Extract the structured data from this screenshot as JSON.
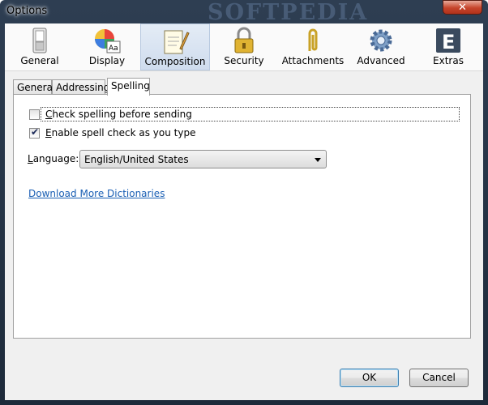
{
  "window": {
    "title": "Options",
    "watermark": "SOFTPEDIA",
    "close_label": "✕"
  },
  "toolbar": {
    "items": [
      {
        "label": "General",
        "icon": "switch-icon"
      },
      {
        "label": "Display",
        "icon": "color-wheel-icon"
      },
      {
        "label": "Composition",
        "icon": "notepad-pencil-icon",
        "selected": true
      },
      {
        "label": "Security",
        "icon": "padlock-icon"
      },
      {
        "label": "Attachments",
        "icon": "paperclip-icon"
      },
      {
        "label": "Advanced",
        "icon": "gear-icon"
      },
      {
        "label": "Extras",
        "icon": "extras-e-icon"
      }
    ]
  },
  "tabs": [
    {
      "label": "General"
    },
    {
      "label": "Addressing"
    },
    {
      "label": "Spelling",
      "active": true
    }
  ],
  "spelling": {
    "check_before_sending": {
      "label_access": "C",
      "label_rest": "heck spelling before sending",
      "checked": false
    },
    "spell_as_you_type": {
      "label_access": "E",
      "label_rest": "nable spell check as you type",
      "checked": true
    },
    "language": {
      "label_access": "L",
      "label_rest": "anguage:",
      "value": "English/United States"
    },
    "download_link": "Download More Dictionaries"
  },
  "buttons": {
    "ok": "OK",
    "cancel": "Cancel"
  },
  "colors": {
    "selected_toolbar_bg": "#cfdcee",
    "link": "#1a5fb4",
    "titlebar": "#1d2a3a"
  }
}
